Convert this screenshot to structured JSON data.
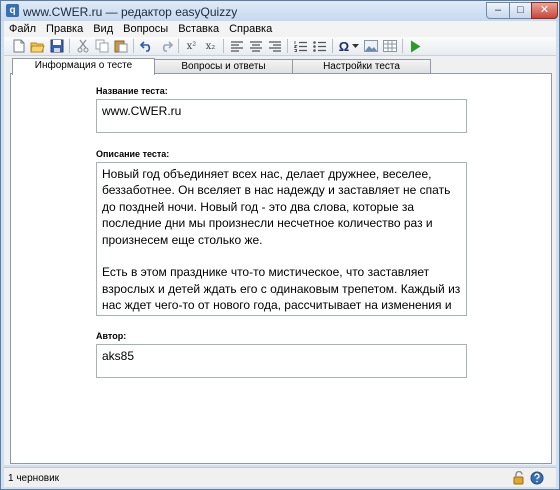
{
  "window": {
    "title": "www.CWER.ru — редактор easyQuizzy",
    "app_icon_letter": "q"
  },
  "window_controls": {
    "minimize": "–",
    "maximize": "□",
    "close": "✕"
  },
  "menu": [
    "Файл",
    "Правка",
    "Вид",
    "Вопросы",
    "Вставка",
    "Справка"
  ],
  "toolbar": {
    "icons": [
      "new-file",
      "open-folder",
      "save",
      "cut",
      "copy",
      "paste",
      "undo",
      "redo",
      "superscript",
      "subscript",
      "align-left",
      "align-center",
      "align-right",
      "numbered-list",
      "bulleted-list",
      "omega-symbol",
      "insert-image",
      "insert-table",
      "play"
    ],
    "superscript_label": "x²",
    "subscript_label": "x₂",
    "omega_label": "Ω"
  },
  "tabs": [
    {
      "label": "Информация о тесте",
      "active": true
    },
    {
      "label": "Вопросы и ответы",
      "active": false
    },
    {
      "label": "Настройки теста",
      "active": false
    }
  ],
  "form": {
    "name_label": "Название теста:",
    "name_value": "www.CWER.ru",
    "description_label": "Описание теста:",
    "description_para1": "Новый год объединяет всех нас, делает дружнее, веселее, беззаботнее. Он вселяет в нас надежду и заставляет не спать до поздней ночи. Новый год - это два слова, которые за последние дни мы произнесли несчетное количество раз и произнесем еще столько же.",
    "description_para2": "Есть в этом празднике что-то мистическое, что заставляет взрослых и детей ждать его с одинаковым трепетом. Каждый из нас ждет чего-то от нового года, рассчитывает на изменения и улучшения, прогресс и рост. Мы очень хотим и желаем вам, чтобы все ваши ожидания оправдались, мечты сбылись, а желания исполнились.",
    "author_label": "Автор:",
    "author_value": "aks85"
  },
  "status": {
    "text": "1 черновик",
    "icons": [
      "lock-open-icon",
      "help-icon"
    ]
  },
  "colors": {
    "titlebar": "#c6d9ef",
    "accent": "#3a6fb0",
    "play": "#2e9a2e"
  }
}
